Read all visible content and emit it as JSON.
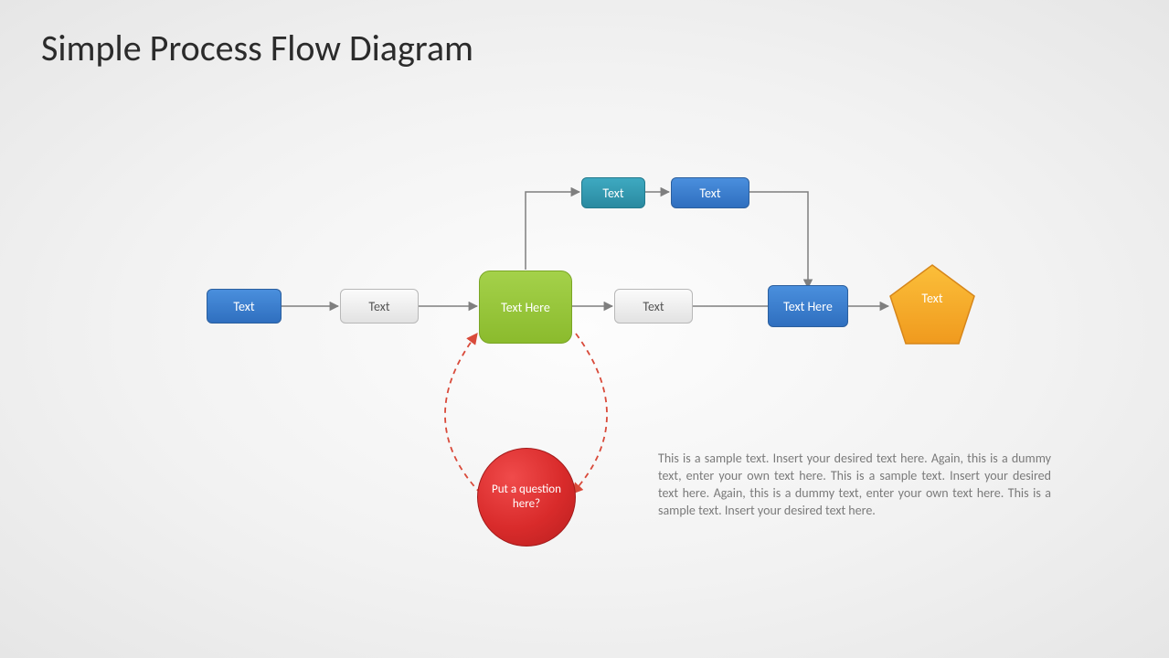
{
  "title": "Simple Process Flow Diagram",
  "nodes": {
    "n1": "Text",
    "n2": "Text",
    "n3": "Text Here",
    "n4": "Text",
    "n5": "Text Here",
    "n6": "Text",
    "top1": "Text",
    "top2": "Text",
    "circle": "Put a question here?"
  },
  "description": "This is a sample text. Insert your desired text here. Again, this is a dummy text, enter your own text here. This is a sample text. Insert your desired text here. Again, this is a dummy text, enter your own text here. This is a sample text. Insert your desired text here.",
  "colors": {
    "blue": "#3a7ac8",
    "gray": "#e8e8e8",
    "green": "#97c63b",
    "teal": "#3399b0",
    "red": "#d92b2b",
    "orange": "#f5a623",
    "connector": "#7f7f7f",
    "dashed": "#d94a3a"
  }
}
